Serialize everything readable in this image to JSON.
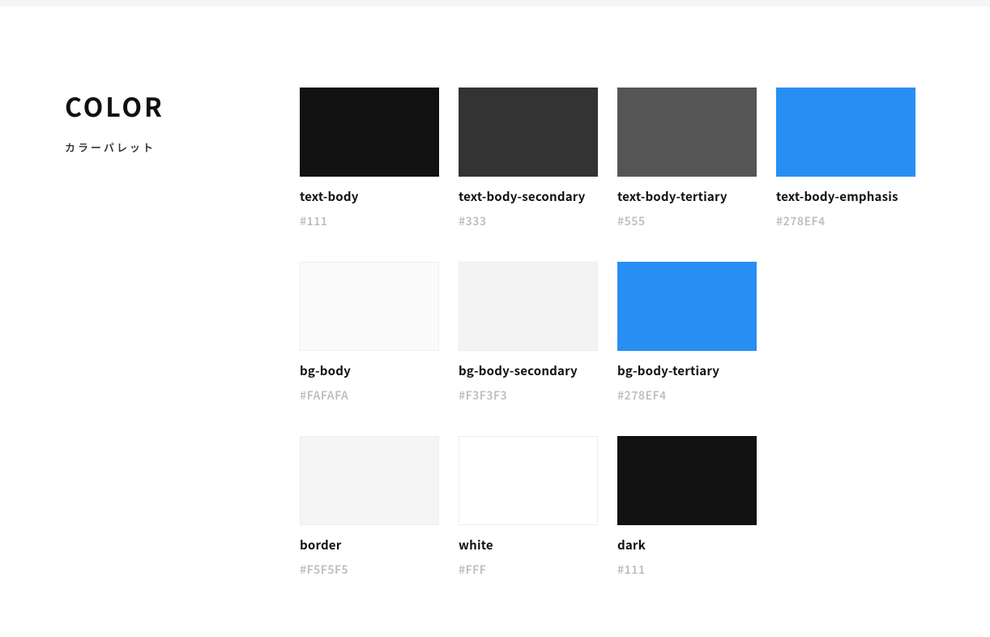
{
  "header": {
    "title": "COLOR",
    "subtitle": "カラーパレット"
  },
  "swatches": [
    {
      "name": "text-body",
      "hex": "#111"
    },
    {
      "name": "text-body-secondary",
      "hex": "#333"
    },
    {
      "name": "text-body-tertiary",
      "hex": "#555"
    },
    {
      "name": "text-body-emphasis",
      "hex": "#278EF4"
    },
    {
      "name": "bg-body",
      "hex": "#FAFAFA"
    },
    {
      "name": "bg-body-secondary",
      "hex": "#F3F3F3"
    },
    {
      "name": "bg-body-tertiary",
      "hex": "#278EF4"
    },
    {
      "name": "border",
      "hex": "#F5F5F5"
    },
    {
      "name": "white",
      "hex": "#FFF"
    },
    {
      "name": "dark",
      "hex": "#111"
    }
  ]
}
